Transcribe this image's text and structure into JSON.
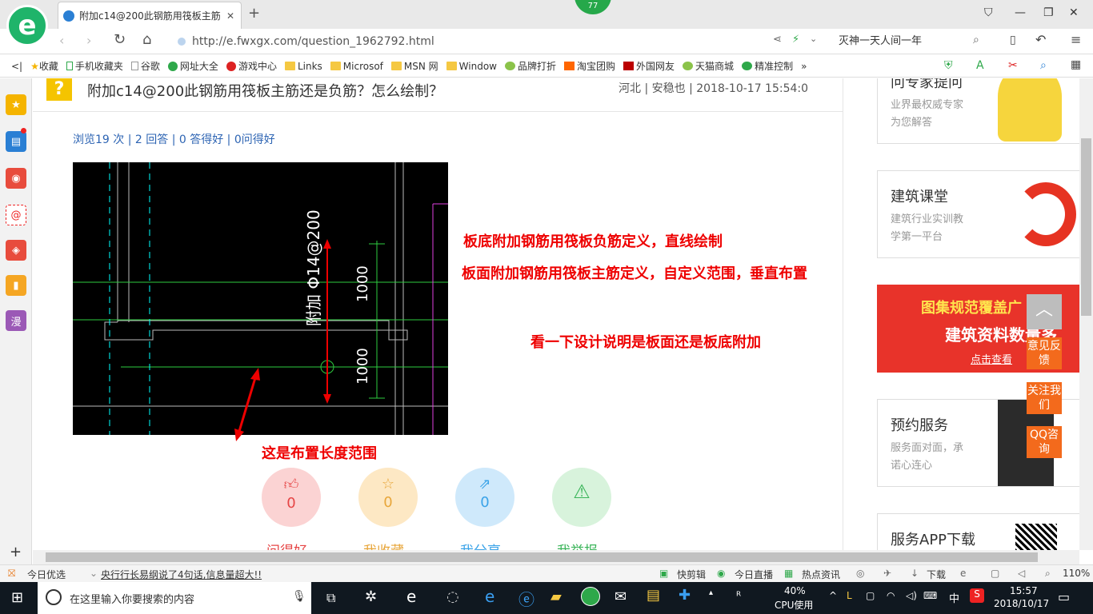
{
  "browser": {
    "tab_title": "附加c14@200此钢筋用筏板主筋",
    "badge": "77",
    "url": "http://e.fwxgx.com/question_1962792.html",
    "search_text": "灭神一天人间一年"
  },
  "bookmarks": [
    "收藏",
    "手机收藏夹",
    "谷歌",
    "网址大全",
    "游戏中心",
    "Links",
    "Microsof",
    "MSN 网",
    "Window",
    "品牌打折",
    "淘宝团购",
    "外国网友",
    "天猫商城",
    "精准控制"
  ],
  "sidebar": {
    "last_label": "漫"
  },
  "question": {
    "title": "附加c14@200此钢筋用筏板主筋还是负筋？怎么绘制？",
    "meta": "河北 | 安稳也 | 2018-10-17 15:54:0",
    "stats": "浏览19 次 | 2 回答 | 0 答得好 | 0问得好",
    "annotations": [
      "板底附加钢筋用筏板负筋定义，直线绘制",
      "板面附加钢筋用筏板主筋定义，自定义范围，垂直布置",
      "看一下设计说明是板面还是板底附加",
      "这是布置长度范围"
    ],
    "cad_labels": {
      "rebar": "附加 Φ14@200",
      "dim1": "1000",
      "dim2": "1000"
    },
    "actions": [
      {
        "label": "问得好",
        "count": "0",
        "icon": "thumb-up",
        "bg": "#fbd3d3",
        "color": "#e64545"
      },
      {
        "label": "我收藏",
        "count": "0",
        "icon": "star",
        "bg": "#fde8c4",
        "color": "#e8a63a"
      },
      {
        "label": "我分享",
        "count": "0",
        "icon": "share",
        "bg": "#cfe9fb",
        "color": "#3aa3e8"
      },
      {
        "label": "我举报",
        "count": "",
        "icon": "warning",
        "bg": "#d8f3dc",
        "color": "#3bb55a"
      }
    ]
  },
  "right_cards": [
    {
      "title": "问专家提问",
      "desc1": "业界最权威专家",
      "desc2": "为您解答"
    },
    {
      "title": "建筑课堂",
      "desc1": "建筑行业实训教",
      "desc2": "学第一平台"
    },
    {
      "title": "图集规范覆盖广",
      "desc1": "建筑资料数量多",
      "desc2": "点击查看"
    },
    {
      "title": "预约服务",
      "desc1": "服务面对面，承",
      "desc2": "诺心连心"
    },
    {
      "title": "服务APP下载",
      "desc1": "",
      "desc2": ""
    }
  ],
  "float_buttons": [
    "意见反馈",
    "关注我们",
    "QQ咨询"
  ],
  "status": {
    "left1": "今日优选",
    "left2": "央行行长易纲说了4句话,信息量超大!!",
    "r1": "快剪辑",
    "r2": "今日直播",
    "r3": "热点资讯",
    "r4": "下载",
    "zoom": "110%"
  },
  "taskbar": {
    "search_placeholder": "在这里输入你要搜索的内容",
    "cpu_pct": "40%",
    "cpu_label": "CPU使用",
    "ime": "中",
    "time": "15:57",
    "date": "2018/10/17"
  }
}
